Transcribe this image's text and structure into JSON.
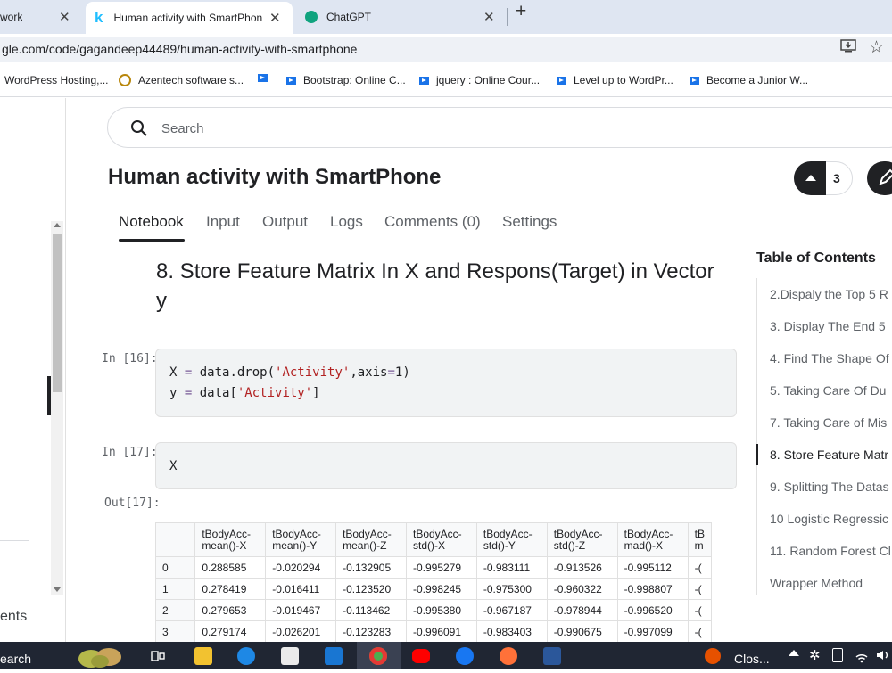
{
  "browser": {
    "tabs": [
      {
        "label": "work",
        "active": false
      },
      {
        "label": "Human activity with SmartPhon",
        "active": true
      },
      {
        "label": "ChatGPT",
        "active": false
      }
    ],
    "new_tab": "+",
    "url": "gle.com/code/gagandeep44489/human-activity-with-smartphone",
    "bookmarks": [
      "WordPress Hosting,...",
      "Azentech software s...",
      "",
      "Bootstrap: Online C...",
      "jquery : Online Cour...",
      "Level up to WordPr...",
      "Become a Junior W..."
    ]
  },
  "sidebar": {
    "partial_label": "ents"
  },
  "search": {
    "placeholder": "Search"
  },
  "header": {
    "title": "Human activity with SmartPhone",
    "upvotes": "3"
  },
  "nav_tabs": [
    "Notebook",
    "Input",
    "Output",
    "Logs",
    "Comments (0)",
    "Settings"
  ],
  "notebook": {
    "heading": "8. Store Feature Matrix In X and Respons(Target) in Vector y",
    "cells": [
      {
        "prompt": "In [16]:"
      },
      {
        "prompt": "In [17]:",
        "code": "X"
      }
    ],
    "out_prompt": "Out[17]:",
    "code16": {
      "l1a": "X ",
      "l1b": "=",
      "l1c": " data.drop(",
      "l1d": "'Activity'",
      "l1e": ",axis",
      "l1f": "=",
      "l1g": "1)",
      "l2a": "y ",
      "l2b": "=",
      "l2c": " data[",
      "l2d": "'Activity'",
      "l2e": "]"
    },
    "table": {
      "columns": [
        "",
        "tBodyAcc-mean()-X",
        "tBodyAcc-mean()-Y",
        "tBodyAcc-mean()-Z",
        "tBodyAcc-std()-X",
        "tBodyAcc-std()-Y",
        "tBodyAcc-std()-Z",
        "tBodyAcc-mad()-X",
        "tB m"
      ],
      "rows": [
        [
          "0",
          "0.288585",
          "-0.020294",
          "-0.132905",
          "-0.995279",
          "-0.983111",
          "-0.913526",
          "-0.995112",
          "-("
        ],
        [
          "1",
          "0.278419",
          "-0.016411",
          "-0.123520",
          "-0.998245",
          "-0.975300",
          "-0.960322",
          "-0.998807",
          "-("
        ],
        [
          "2",
          "0.279653",
          "-0.019467",
          "-0.113462",
          "-0.995380",
          "-0.967187",
          "-0.978944",
          "-0.996520",
          "-("
        ],
        [
          "3",
          "0.279174",
          "-0.026201",
          "-0.123283",
          "-0.996091",
          "-0.983403",
          "-0.990675",
          "-0.997099",
          "-("
        ]
      ]
    }
  },
  "toc": {
    "title": "Table of Contents",
    "items": [
      "2.Dispaly the Top 5 R",
      "3. Display The End 5",
      "4. Find The Shape Of",
      "5. Taking Care Of Du",
      "7. Taking Care of Mis",
      "8. Store Feature Matr",
      "9. Splitting The Datas",
      "10 Logistic Regressic",
      "11. Random Forest Cl",
      "Wrapper Method"
    ],
    "active_index": 5
  },
  "taskbar": {
    "search_label": "earch",
    "weather_label": "Clos..."
  },
  "colors": {
    "accent": "#202124",
    "kaggle": "#20beff",
    "string": "#b22222"
  }
}
